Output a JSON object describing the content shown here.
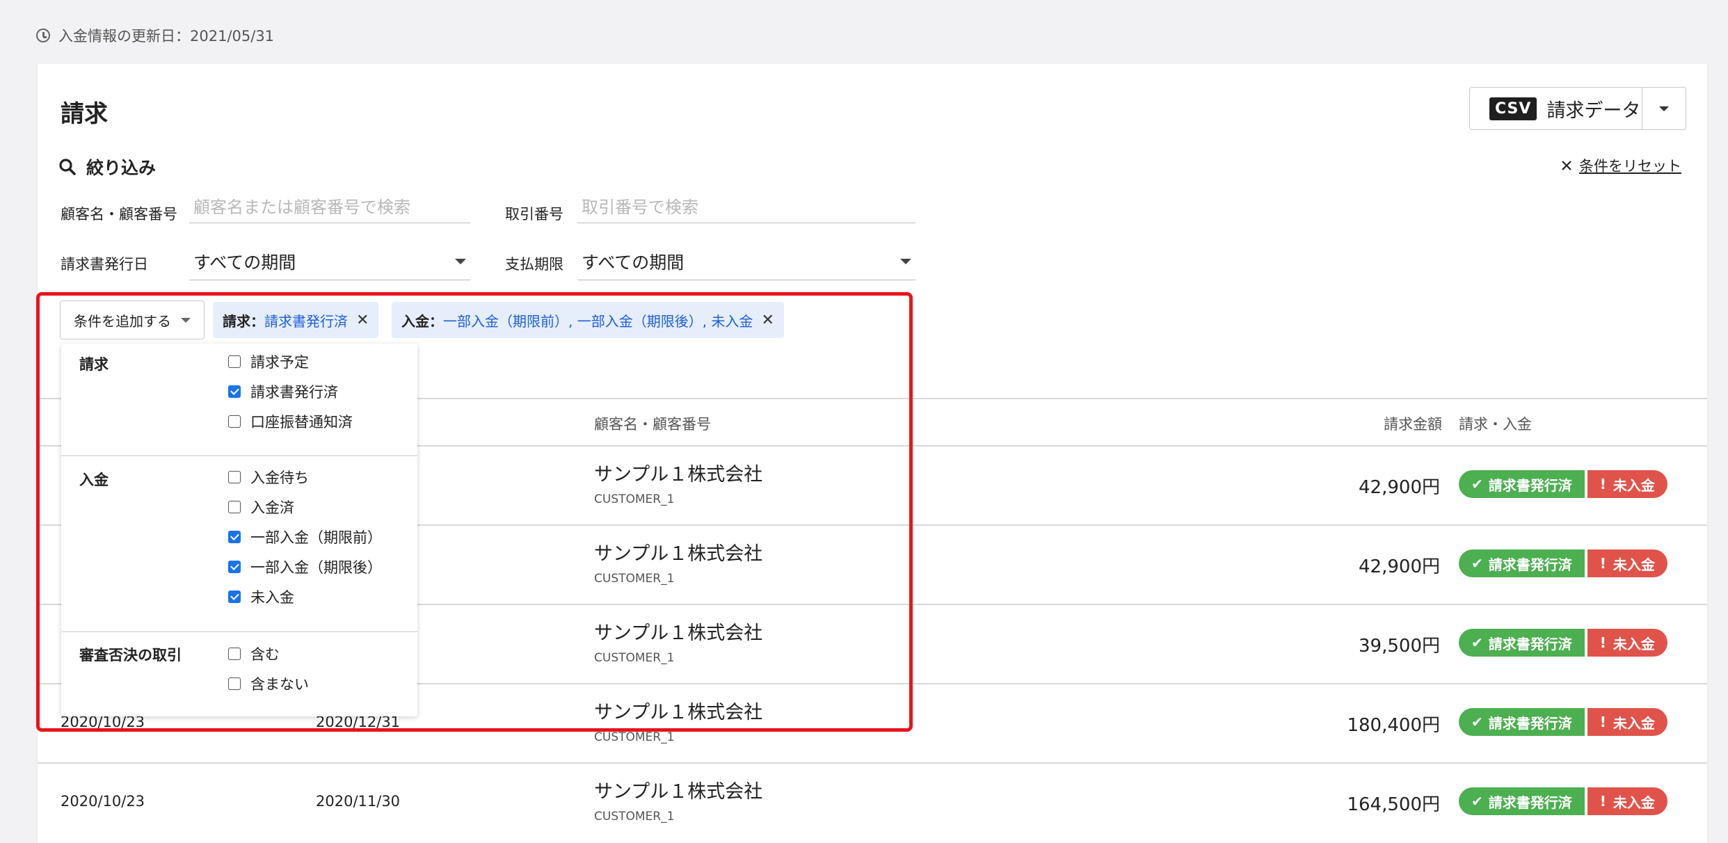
{
  "updated_label": "入金情報の更新日：2021/05/31",
  "page_title": "請求",
  "csv_button": {
    "badge": "CSV",
    "label": "請求データ"
  },
  "filter": {
    "heading": "絞り込み",
    "reset_label": "条件をリセット",
    "customer_label": "顧客名・顧客番号",
    "customer_placeholder": "顧客名または顧客番号で検索",
    "transaction_label": "取引番号",
    "transaction_placeholder": "取引番号で検索",
    "issue_date_label": "請求書発行日",
    "issue_date_value": "すべての期間",
    "due_label": "支払期限",
    "due_value": "すべての期間",
    "add_condition_label": "条件を追加する",
    "chips": [
      {
        "key": "請求：",
        "value": "請求書発行済"
      },
      {
        "key": "入金：",
        "value": "一部入金（期限前）, 一部入金（期限後）, 未入金"
      }
    ]
  },
  "dropdown": {
    "groups": [
      {
        "title": "請求",
        "options": [
          {
            "label": "請求予定",
            "checked": false
          },
          {
            "label": "請求書発行済",
            "checked": true
          },
          {
            "label": "口座振替通知済",
            "checked": false
          }
        ]
      },
      {
        "title": "入金",
        "options": [
          {
            "label": "入金待ち",
            "checked": false
          },
          {
            "label": "入金済",
            "checked": false
          },
          {
            "label": "一部入金（期限前）",
            "checked": true
          },
          {
            "label": "一部入金（期限後）",
            "checked": true
          },
          {
            "label": "未入金",
            "checked": true
          }
        ]
      },
      {
        "title": "審査否決の取引",
        "options": [
          {
            "label": "含む",
            "checked": false
          },
          {
            "label": "含まない",
            "checked": false
          }
        ]
      }
    ]
  },
  "table": {
    "headers": {
      "customer": "顧客名・顧客番号",
      "amount": "請求金額",
      "status": "請求・入金"
    },
    "rows": [
      {
        "issue_date": "",
        "due_date": "",
        "customer": "サンプル１株式会社",
        "customer_id": "CUSTOMER_1",
        "amount": "42,900円",
        "billing_status": "請求書発行済",
        "payment_status": "未入金"
      },
      {
        "issue_date": "",
        "due_date": "",
        "customer": "サンプル１株式会社",
        "customer_id": "CUSTOMER_1",
        "amount": "42,900円",
        "billing_status": "請求書発行済",
        "payment_status": "未入金"
      },
      {
        "issue_date": "",
        "due_date": "",
        "customer": "サンプル１株式会社",
        "customer_id": "CUSTOMER_1",
        "amount": "39,500円",
        "billing_status": "請求書発行済",
        "payment_status": "未入金"
      },
      {
        "issue_date": "2020/10/23",
        "due_date": "2020/12/31",
        "customer": "サンプル１株式会社",
        "customer_id": "CUSTOMER_1",
        "amount": "180,400円",
        "billing_status": "請求書発行済",
        "payment_status": "未入金"
      },
      {
        "issue_date": "2020/10/23",
        "due_date": "2020/11/30",
        "customer": "サンプル１株式会社",
        "customer_id": "CUSTOMER_1",
        "amount": "164,500円",
        "billing_status": "請求書発行済",
        "payment_status": "未入金"
      }
    ]
  },
  "colors": {
    "highlight_box": "#e8141b",
    "chip_bg": "#e6eefc",
    "chip_value": "#1e5fd6",
    "badge_green": "#4caf50",
    "badge_red": "#e0534a",
    "checkbox": "#1a73e8"
  }
}
